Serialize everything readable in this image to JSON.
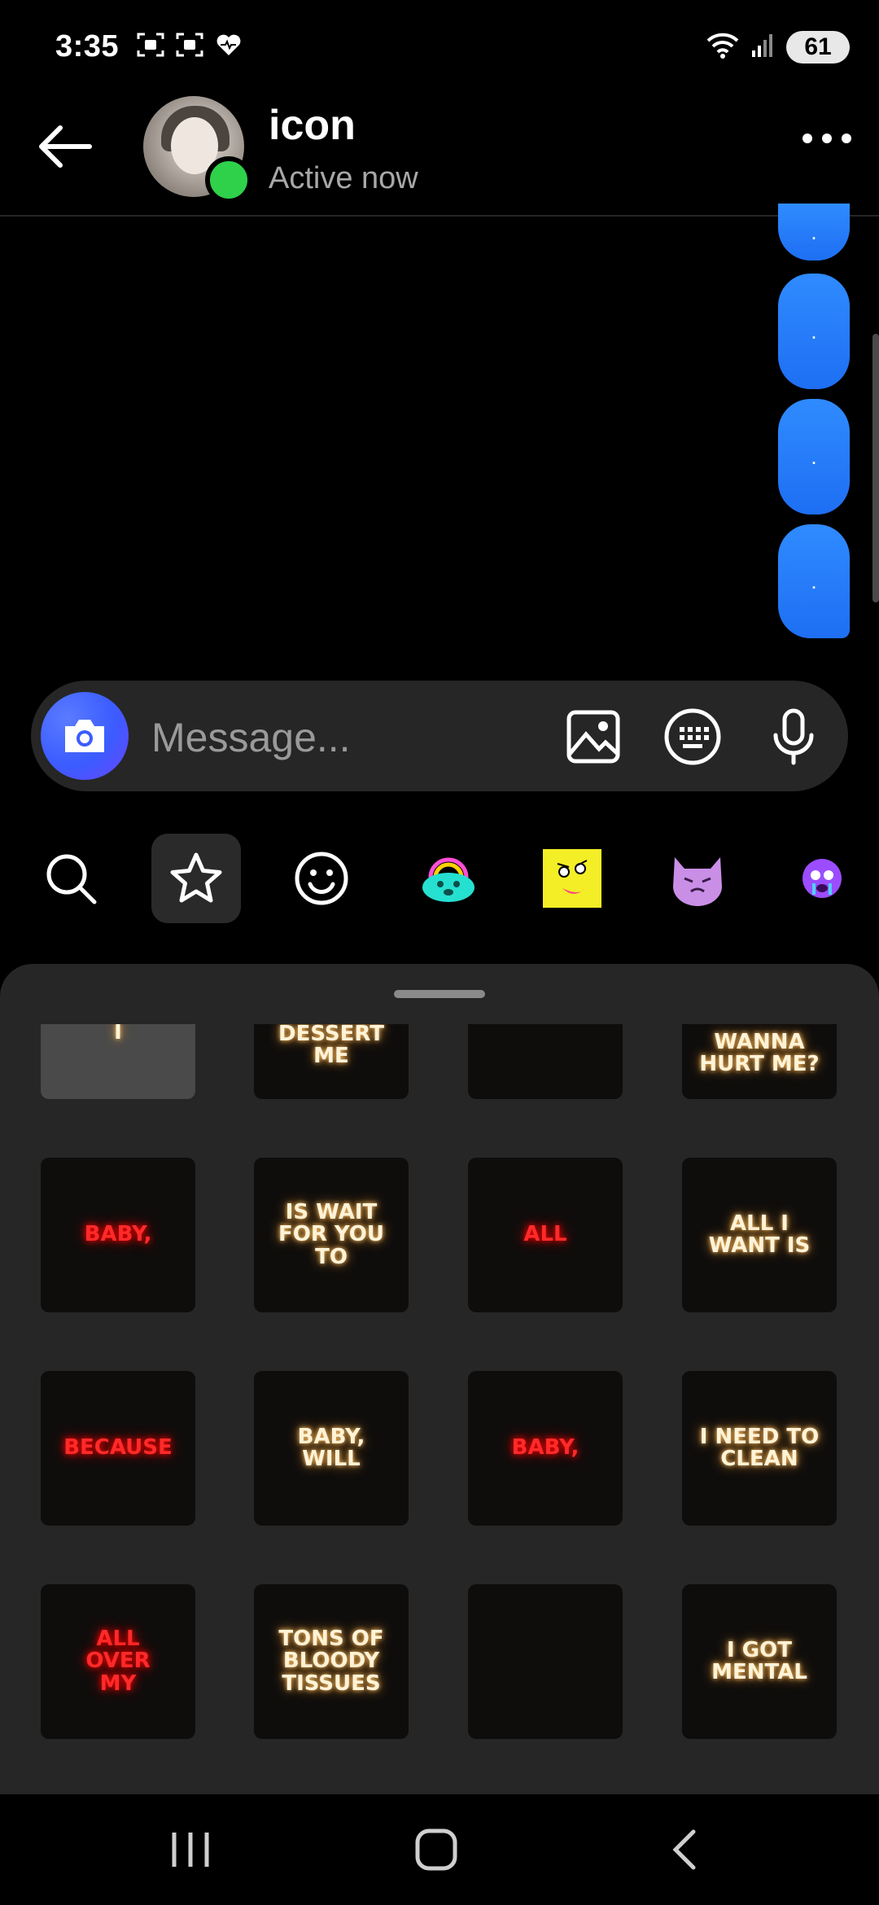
{
  "status_bar": {
    "time": "3:35",
    "battery": "61",
    "network": "5"
  },
  "header": {
    "name": "icon",
    "status": "Active now"
  },
  "messages": [
    {
      "text": "."
    },
    {
      "text": "."
    },
    {
      "text": "."
    },
    {
      "text": "."
    }
  ],
  "composer": {
    "placeholder": "Message..."
  },
  "sticker_grid": {
    "row0": [
      "I",
      "DESSERT\nME",
      "",
      "WANNA\nHURT ME?"
    ],
    "row1": [
      "BABY,",
      "IS WAIT\nFOR YOU\nTO",
      "ALL",
      "ALL I\nWANT IS"
    ],
    "row2": [
      "BECAUSE",
      "BABY,\nWILL",
      "BABY,",
      "I NEED TO\nCLEAN"
    ],
    "row3": [
      "ALL\nOVER\nMY",
      "TONS OF\nBLOODY\nTISSUES",
      "",
      "I GOT\nMENTAL"
    ]
  },
  "colors": {
    "accent": "#1e6ff3",
    "online": "#2fd14a",
    "sheet_bg": "#262626"
  }
}
